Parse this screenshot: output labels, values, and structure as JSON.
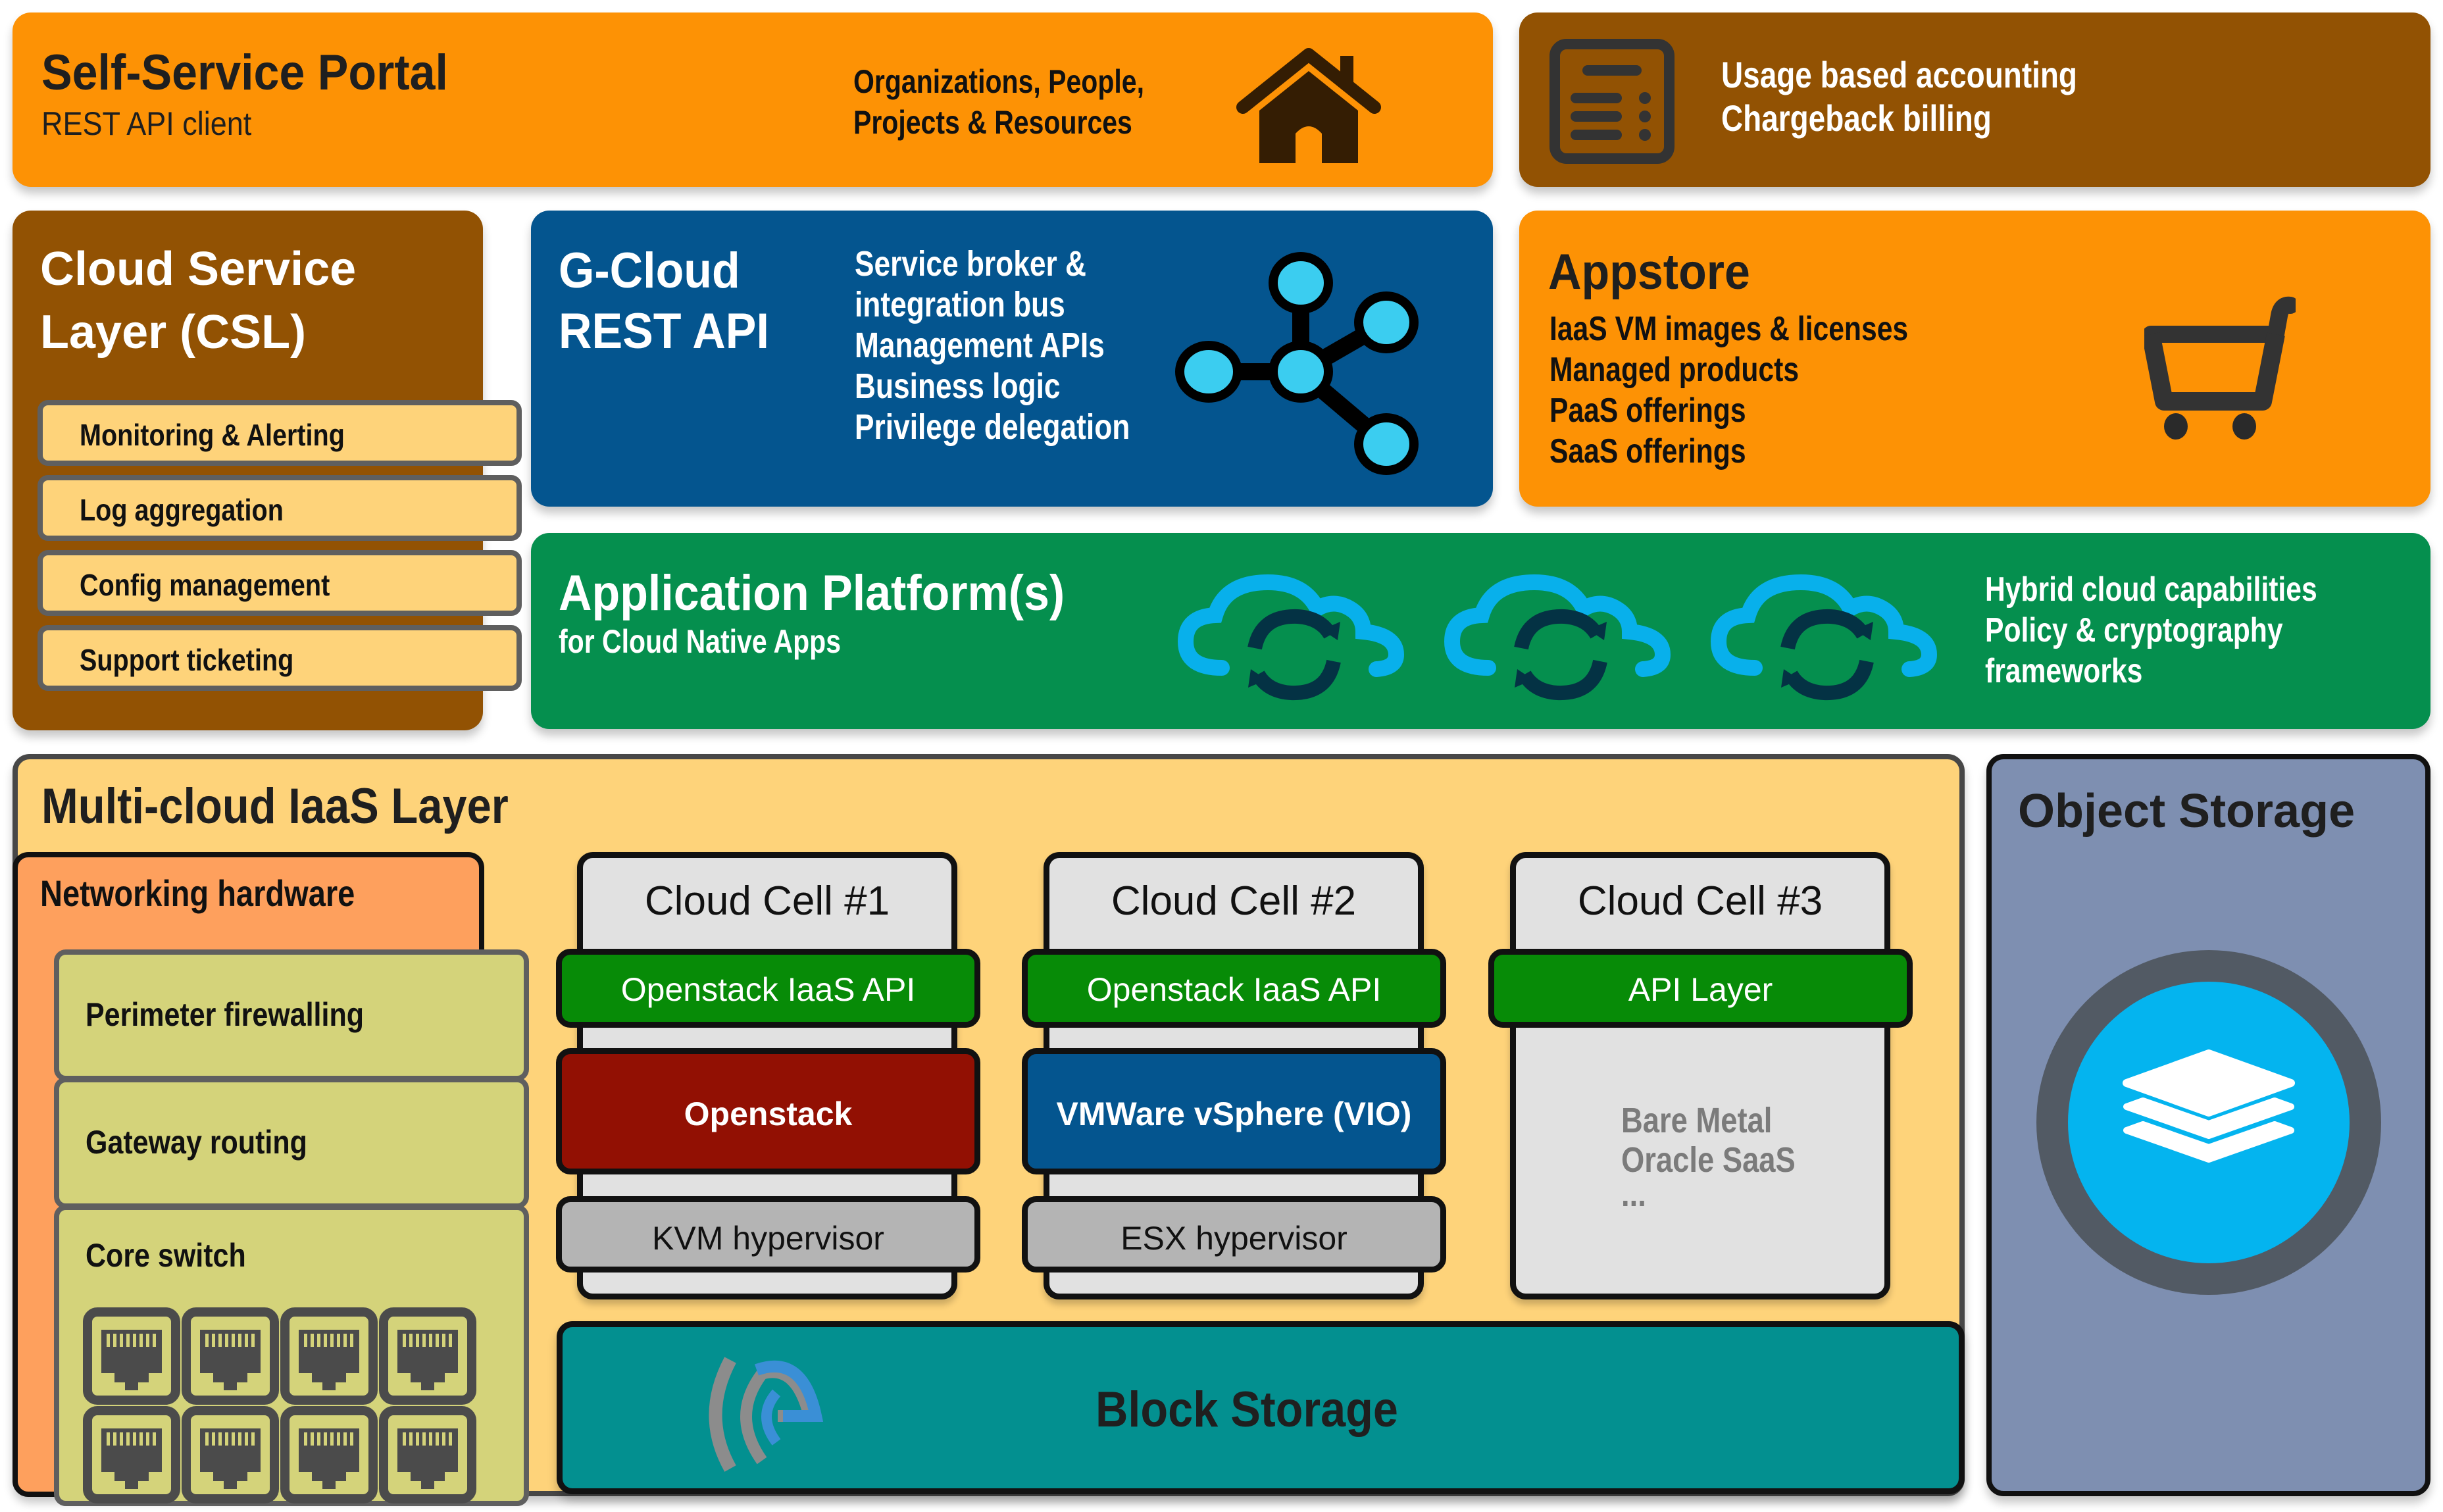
{
  "portal": {
    "title": "Self-Service Portal",
    "subtitle": "REST API client",
    "lines": [
      "Organizations, People,",
      "Projects & Resources"
    ],
    "icon": "home-icon"
  },
  "usage": {
    "lines": [
      "Usage based accounting",
      "Chargeback billing"
    ],
    "icon": "billing-document-icon"
  },
  "csl": {
    "title_lines": [
      "Cloud Service",
      "Layer (CSL)"
    ],
    "items": [
      "Monitoring & Alerting",
      "Log aggregation",
      "Config management",
      "Support ticketing"
    ]
  },
  "gcloud": {
    "title_lines": [
      "G-Cloud",
      "REST API"
    ],
    "features": [
      "Service broker &",
      "integration bus",
      "Management APIs",
      "Business logic",
      "Privilege delegation"
    ],
    "icon": "network-hub-icon"
  },
  "appstore": {
    "title": "Appstore",
    "items": [
      "IaaS VM images & licenses",
      "Managed products",
      "PaaS offerings",
      "SaaS offerings"
    ],
    "icon": "shopping-cart-icon"
  },
  "app_platform": {
    "title": "Application Platform(s)",
    "subtitle": "for Cloud Native Apps",
    "features": [
      "Hybrid cloud capabilities",
      "Policy & cryptography",
      "frameworks"
    ],
    "icon": "cloud-sync-icon",
    "icon_count": 3
  },
  "iaas": {
    "title": "Multi-cloud IaaS Layer",
    "networking": {
      "title": "Networking hardware",
      "items": [
        "Perimeter firewalling",
        "Gateway routing",
        "Core switch"
      ],
      "port_icon": "ethernet-port-icon",
      "port_count": 8
    },
    "cells": [
      {
        "title": "Cloud Cell #1",
        "api": "Openstack IaaS API",
        "core": "Openstack",
        "hypervisor": "KVM hypervisor"
      },
      {
        "title": "Cloud Cell #2",
        "api": "Openstack IaaS API",
        "core": "VMWare vSphere (VIO)",
        "hypervisor": "ESX hypervisor"
      },
      {
        "title": "Cloud Cell #3",
        "api": "API Layer",
        "extras": [
          "Bare Metal",
          "Oracle SaaS",
          "..."
        ]
      }
    ],
    "block_storage": {
      "title": "Block Storage",
      "icon": "storage-logo-icon"
    }
  },
  "object_storage": {
    "title": "Object Storage",
    "icon": "layers-icon"
  },
  "colors": {
    "orange": "#fd9205",
    "brown": "#925203",
    "blue": "#04558f",
    "green": "#058f4e",
    "light_yellow": "#fed37a",
    "cell_api_green": "#078b07",
    "openstack_red": "#921003",
    "block_teal": "#039090",
    "object_slate": "#7e8fb1",
    "cyan_accent": "#3bcdf0"
  }
}
